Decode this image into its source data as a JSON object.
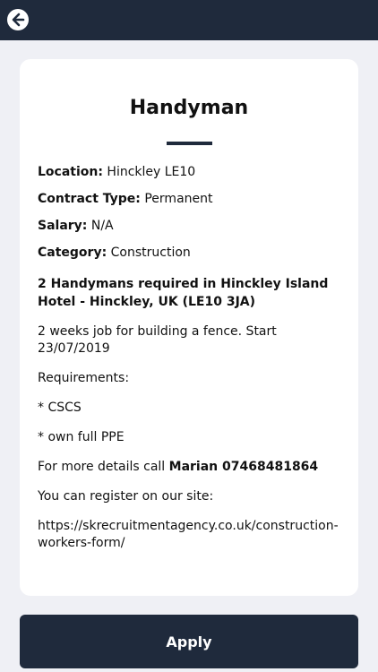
{
  "topbar": {
    "back_icon": "arrow-left-circle-icon"
  },
  "job": {
    "title": "Handyman",
    "location_label": "Location:",
    "location_value": "Hinckley LE10",
    "contract_label": "Contract Type:",
    "contract_value": "Permanent",
    "salary_label": "Salary:",
    "salary_value": "N/A",
    "category_label": "Category:",
    "category_value": "Construction",
    "headline": "2 Handymans required in Hinckley Island Hotel - Hinckley, UK (LE10 3JA)",
    "description": "2 weeks job for building a fence. Start 23/07/2019",
    "requirements_label": "Requirements:",
    "requirement_1": "* CSCS",
    "requirement_2": "* own full PPE",
    "contact_prefix": "For more details call ",
    "contact_name_phone": "Marian 07468481864",
    "register_text": "You can register on our site:",
    "register_url": "https://skrecruitmentagency.co.uk/construction-workers-form/"
  },
  "actions": {
    "apply_label": "Apply"
  },
  "colors": {
    "navy": "#1f2a3c",
    "background": "#eff0f5",
    "card": "#ffffff"
  }
}
